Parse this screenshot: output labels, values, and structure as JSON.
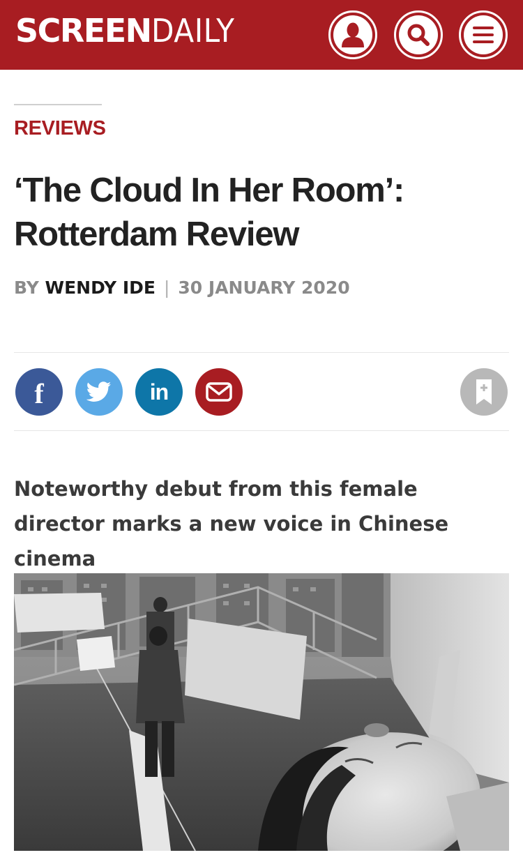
{
  "site": {
    "logo_bold": "SCREEN",
    "logo_light": "DAILY",
    "brand_color": "#a81d22"
  },
  "header_icons": [
    {
      "name": "user-icon"
    },
    {
      "name": "search-icon"
    },
    {
      "name": "menu-icon"
    }
  ],
  "article": {
    "section": "REVIEWS",
    "headline": "‘The Cloud In Her Room’: Rotterdam Review",
    "byline_prefix": "BY",
    "author": "WENDY IDE",
    "separator": "|",
    "date": "30 JANUARY 2020",
    "standfirst": "Noteworthy debut from this female director marks a new voice in Chinese cinema"
  },
  "share": {
    "facebook_glyph": "f",
    "linkedin_glyph": "in",
    "icons": [
      "facebook-icon",
      "twitter-icon",
      "linkedin-icon",
      "email-icon",
      "bookmark-icon"
    ],
    "colors": {
      "facebook": "#3b5998",
      "twitter": "#5aa9e6",
      "linkedin": "#0e76a8",
      "email": "#a81d22",
      "bookmark": "#b8b8b8"
    }
  },
  "photo": {
    "style": "black-and-white",
    "subject": "rooftop-scene"
  }
}
